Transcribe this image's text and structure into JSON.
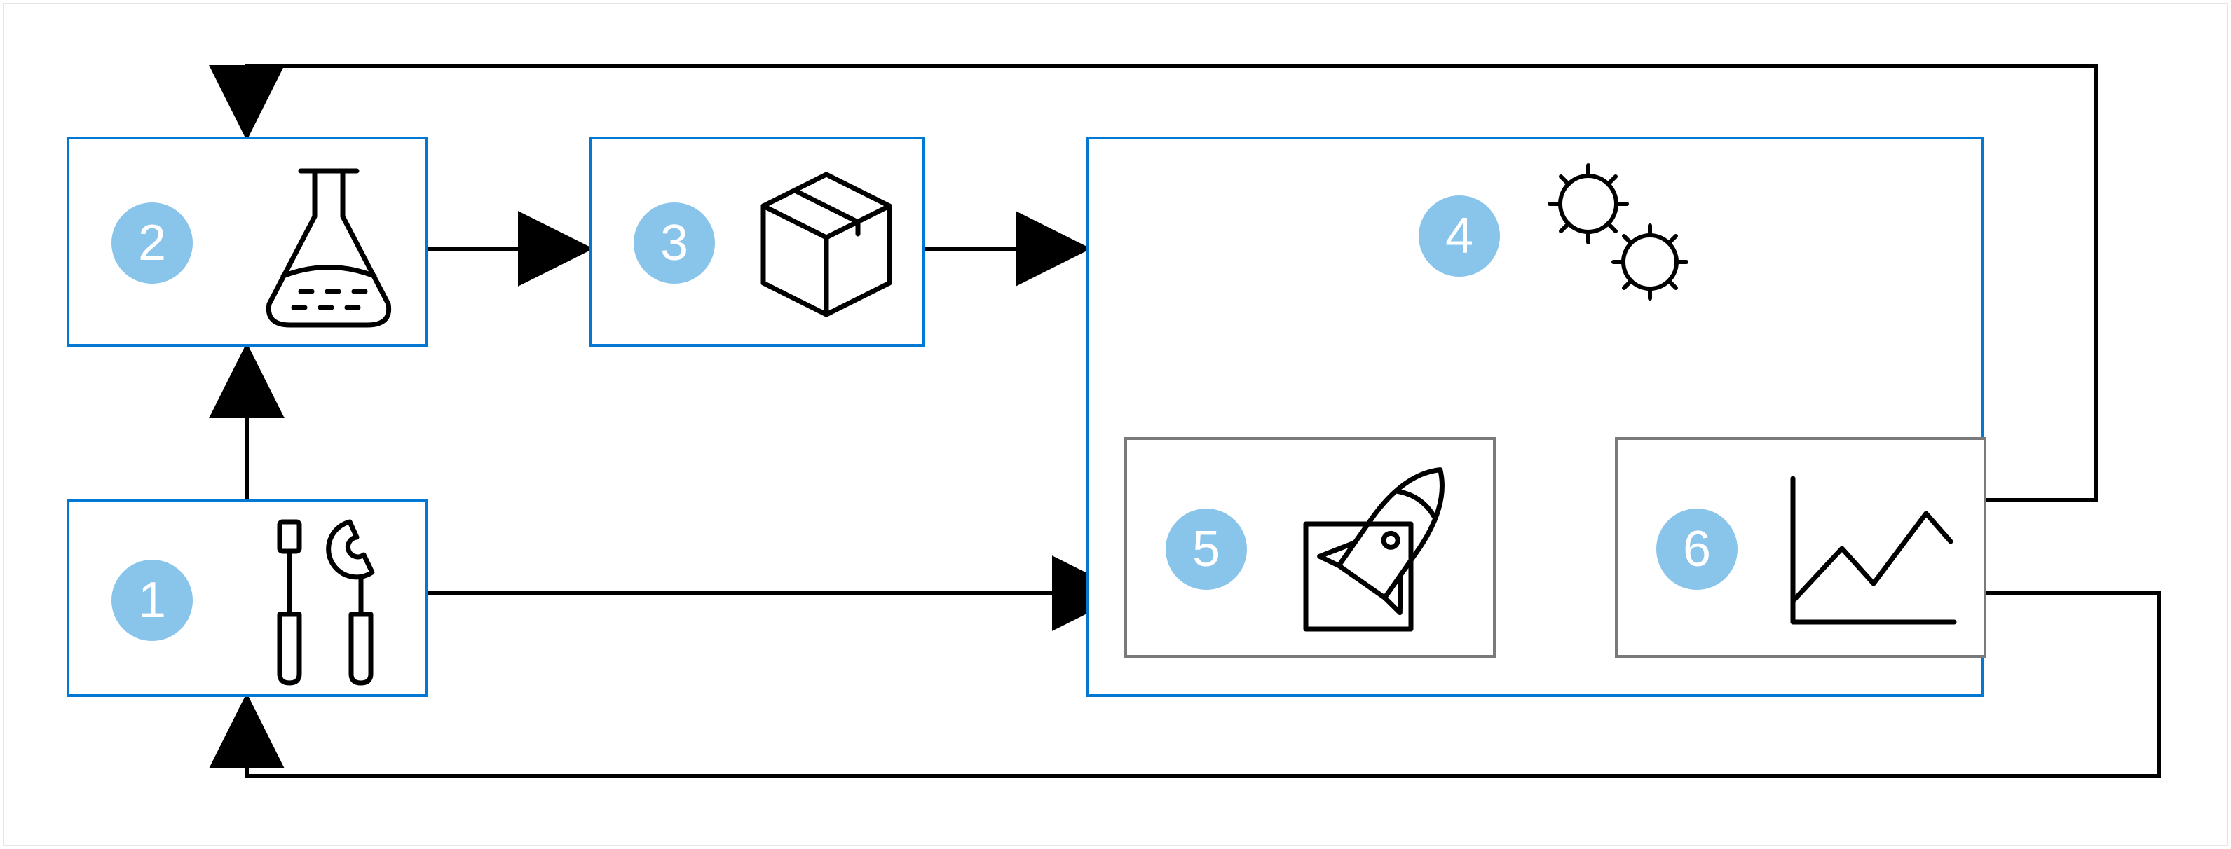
{
  "colors": {
    "blue_border": "#0078D4",
    "gray_border": "#7a7a7a",
    "badge_fill": "#89C4EB",
    "arrow": "#000000"
  },
  "nodes": {
    "n1": {
      "num": "1",
      "icon_name": "tools-icon"
    },
    "n2": {
      "num": "2",
      "icon_name": "flask-icon"
    },
    "n3": {
      "num": "3",
      "icon_name": "package-icon"
    },
    "n4": {
      "num": "4",
      "icon_name": "gears-icon"
    },
    "n5": {
      "num": "5",
      "icon_name": "rocket-icon"
    },
    "n6": {
      "num": "6",
      "icon_name": "chart-icon"
    }
  }
}
